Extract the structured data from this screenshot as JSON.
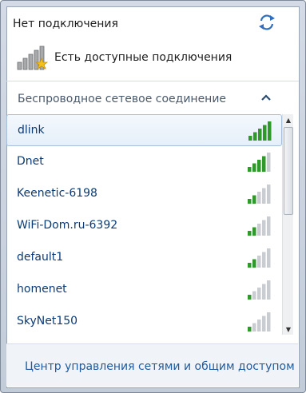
{
  "header": {
    "status_title": "Нет подключения",
    "available_text": "Есть доступные подключения"
  },
  "section": {
    "label": "Беспроводное сетевое соединение"
  },
  "networks": [
    {
      "name": "dlink",
      "signal_bars": 5,
      "selected": true
    },
    {
      "name": "Dnet",
      "signal_bars": 4
    },
    {
      "name": "Keenetic-6198",
      "signal_bars": 2
    },
    {
      "name": "WiFi-Dom.ru-6392",
      "signal_bars": 2
    },
    {
      "name": "default1",
      "signal_bars": 2
    },
    {
      "name": "homenet",
      "signal_bars": 1
    },
    {
      "name": "SkyNet150",
      "signal_bars": 1
    }
  ],
  "footer": {
    "link": "Центр управления сетями и общим доступом"
  },
  "colors": {
    "signal_active": "#2f9a2a",
    "signal_inactive": "#c9ccd0",
    "link": "#1f5a9e"
  },
  "icons": {
    "refresh": "refresh-icon",
    "available_networks": "network-bars-star-icon",
    "collapse": "chevron-up-icon"
  }
}
